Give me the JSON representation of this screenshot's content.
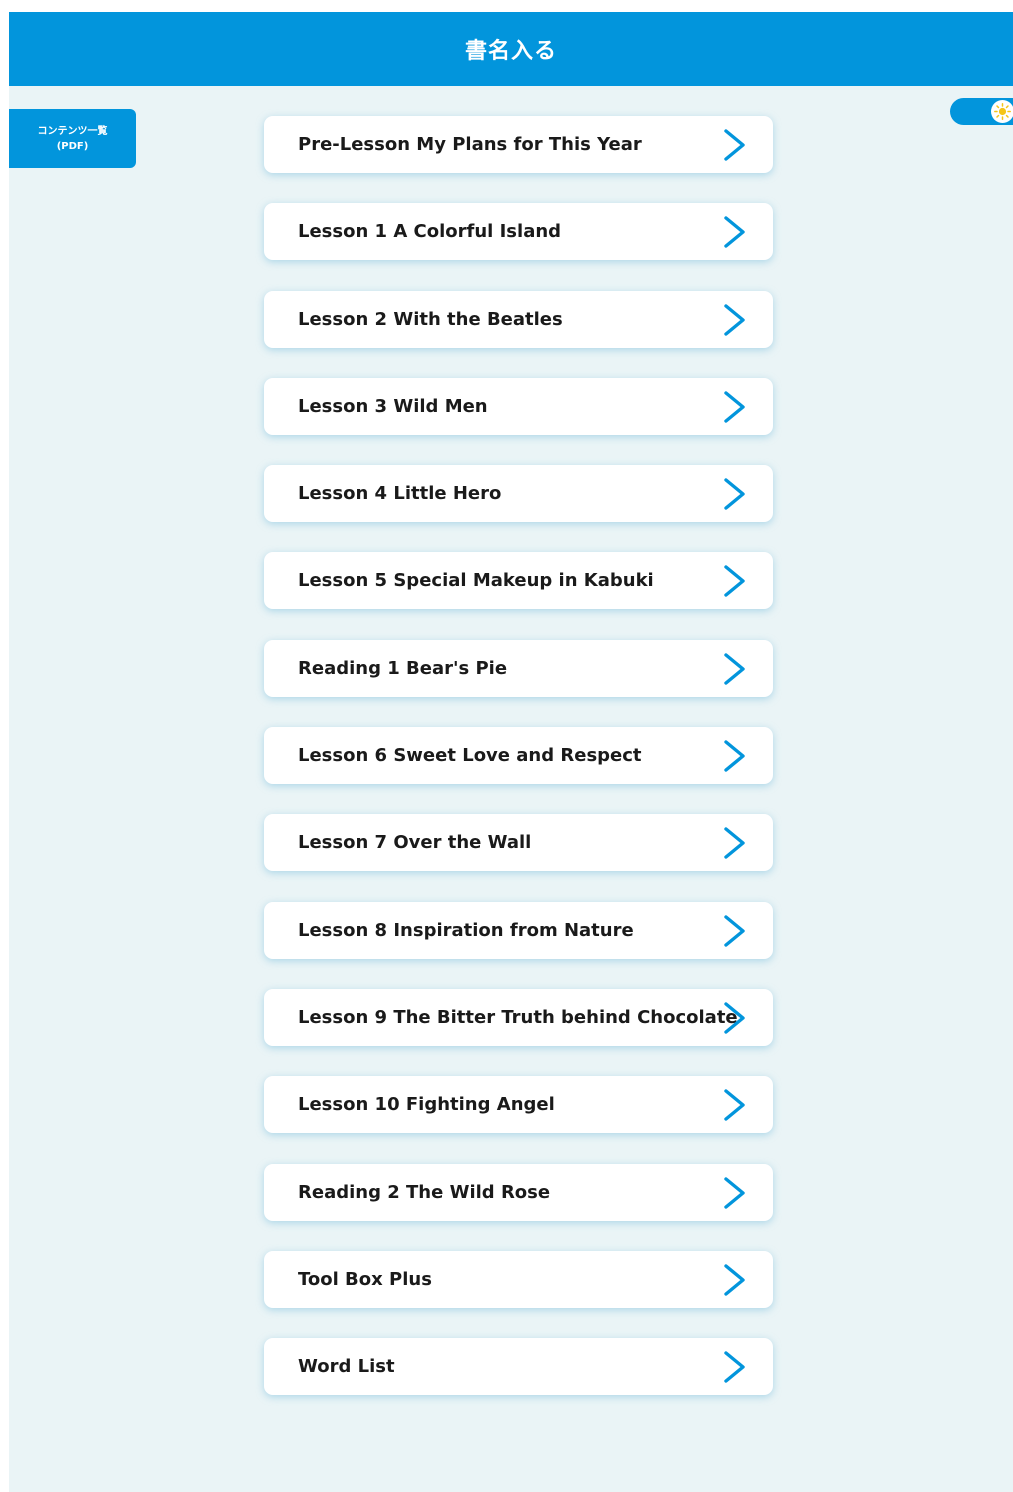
{
  "header": {
    "title": "書名入る"
  },
  "sidebar": {
    "pdf_button": {
      "line1": "コンテンツ一覧",
      "line2": "(PDF)"
    }
  },
  "theme_toggle": {
    "state": "light",
    "icon": "sun-icon"
  },
  "lessons": [
    {
      "label": "Pre-Lesson My Plans for This Year",
      "icon": "chevron-right-icon"
    },
    {
      "label": "Lesson 1 A Colorful Island",
      "icon": "chevron-right-icon"
    },
    {
      "label": "Lesson 2 With the Beatles",
      "icon": "chevron-right-icon"
    },
    {
      "label": "Lesson 3 Wild Men",
      "icon": "chevron-right-icon"
    },
    {
      "label": "Lesson 4 Little Hero",
      "icon": "chevron-right-icon"
    },
    {
      "label": "Lesson 5 Special Makeup in Kabuki",
      "icon": "chevron-right-icon"
    },
    {
      "label": "Reading 1 Bear's Pie",
      "icon": "chevron-right-icon"
    },
    {
      "label": "Lesson 6 Sweet Love and Respect",
      "icon": "chevron-right-icon"
    },
    {
      "label": "Lesson 7 Over the Wall",
      "icon": "chevron-right-icon"
    },
    {
      "label": "Lesson 8 Inspiration from Nature",
      "icon": "chevron-right-icon"
    },
    {
      "label": "Lesson 9 The Bitter Truth behind Chocolate",
      "icon": "chevron-right-icon"
    },
    {
      "label": "Lesson 10 Fighting Angel",
      "icon": "chevron-right-icon"
    },
    {
      "label": "Reading 2 The Wild Rose",
      "icon": "chevron-right-icon"
    },
    {
      "label": "Tool Box Plus",
      "icon": "chevron-right-icon"
    },
    {
      "label": "Word List",
      "icon": "chevron-right-icon"
    }
  ],
  "colors": {
    "accent": "#0295dc",
    "background": "#eaf4f6",
    "card": "#ffffff",
    "text": "#1a1a1a",
    "sun": "#f5c518"
  }
}
